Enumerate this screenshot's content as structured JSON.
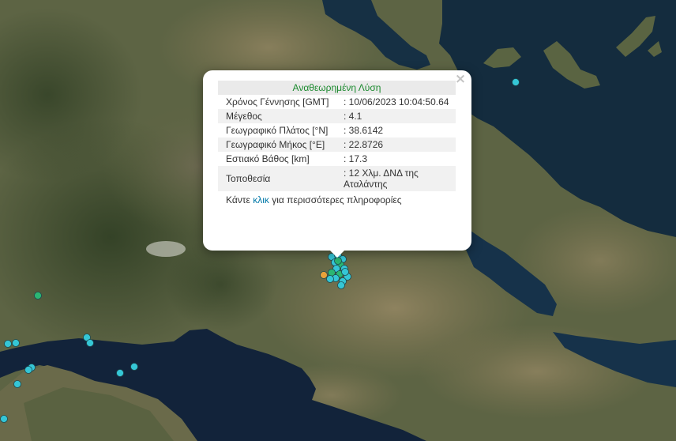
{
  "popup": {
    "title": "Αναθεωρημένη Λύση",
    "close": "×",
    "rows": [
      {
        "label": "Χρόνος Γέννησης [GMT]",
        "value": ": 10/06/2023 10:04:50.64"
      },
      {
        "label": "Μέγεθος",
        "value": ": 4.1"
      },
      {
        "label": "Γεωγραφικό Πλάτος [°N]",
        "value": ": 38.6142"
      },
      {
        "label": "Γεωγραφικό Μήκος [°E]",
        "value": ": 22.8726"
      },
      {
        "label": "Εστιακό Βάθος [km]",
        "value": ": 17.3"
      },
      {
        "label": "Τοποθεσία",
        "value": ": 12 Χλμ. ΔΝΔ της Αταλάντης"
      }
    ],
    "more_prefix": "Κάντε ",
    "more_link": "κλικ",
    "more_suffix": " για περισσότερες πληροφορίες"
  },
  "marker_colors": {
    "cyan": "#35c6d6",
    "green": "#2bb673",
    "orange": "#e8a13a"
  }
}
